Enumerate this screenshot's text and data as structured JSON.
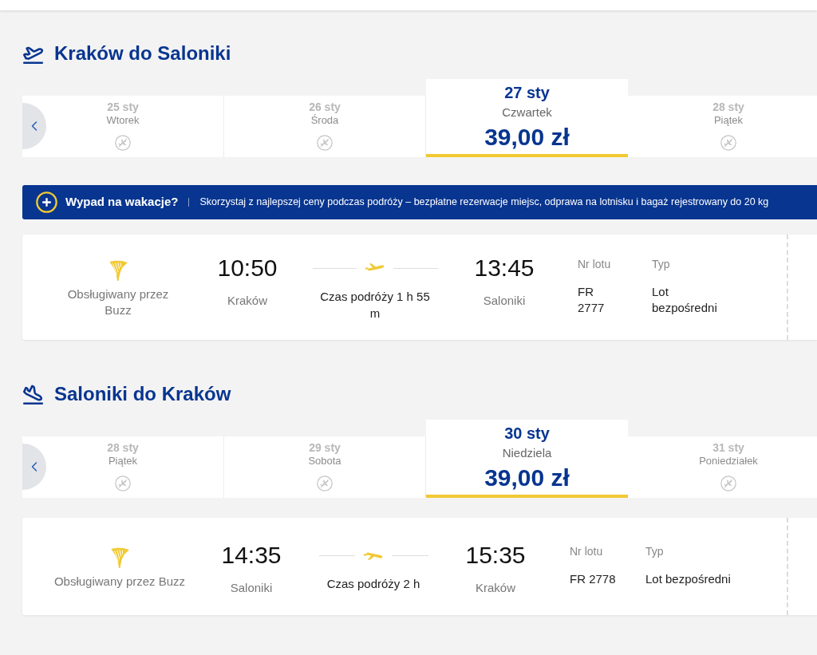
{
  "sections": [
    {
      "title": "Kraków do Saloniki",
      "dates": [
        {
          "date": "25 sty",
          "day": "Wtorek",
          "selected": false
        },
        {
          "date": "26 sty",
          "day": "Środa",
          "selected": false
        },
        {
          "date": "27 sty",
          "day": "Czwartek",
          "price": "39,00 zł",
          "selected": true
        },
        {
          "date": "28 sty",
          "day": "Piątek",
          "selected": false
        }
      ],
      "banner": {
        "title": "Wypad na wakacje?",
        "text": "Skorzystaj z najlepszej ceny podczas podróży – bezpłatne rezerwacje miejsc, odprawa na lotnisku i bagaż rejestrowany do 20 kg"
      },
      "flight": {
        "operator": "Obsługiwany przez Buzz",
        "departure_time": "10:50",
        "departure_city": "Kraków",
        "duration": "Czas podróży 1 h 55 m",
        "arrival_time": "13:45",
        "arrival_city": "Saloniki",
        "flight_number_label": "Nr lotu",
        "flight_number": "FR 2777",
        "type_label": "Typ",
        "type": "Lot bezpośredni"
      }
    },
    {
      "title": "Saloniki do Kraków",
      "dates": [
        {
          "date": "28 sty",
          "day": "Piątek",
          "selected": false
        },
        {
          "date": "29 sty",
          "day": "Sobota",
          "selected": false
        },
        {
          "date": "30 sty",
          "day": "Niedziela",
          "price": "39,00 zł",
          "selected": true
        },
        {
          "date": "31 sty",
          "day": "Poniedziałek",
          "selected": false
        }
      ],
      "flight": {
        "operator": "Obsługiwany przez Buzz",
        "departure_time": "14:35",
        "departure_city": "Saloniki",
        "duration": "Czas podróży 2 h",
        "arrival_time": "15:35",
        "arrival_city": "Kraków",
        "flight_number_label": "Nr lotu",
        "flight_number": "FR 2778",
        "type_label": "Typ",
        "type": "Lot bezpośredni"
      }
    }
  ]
}
